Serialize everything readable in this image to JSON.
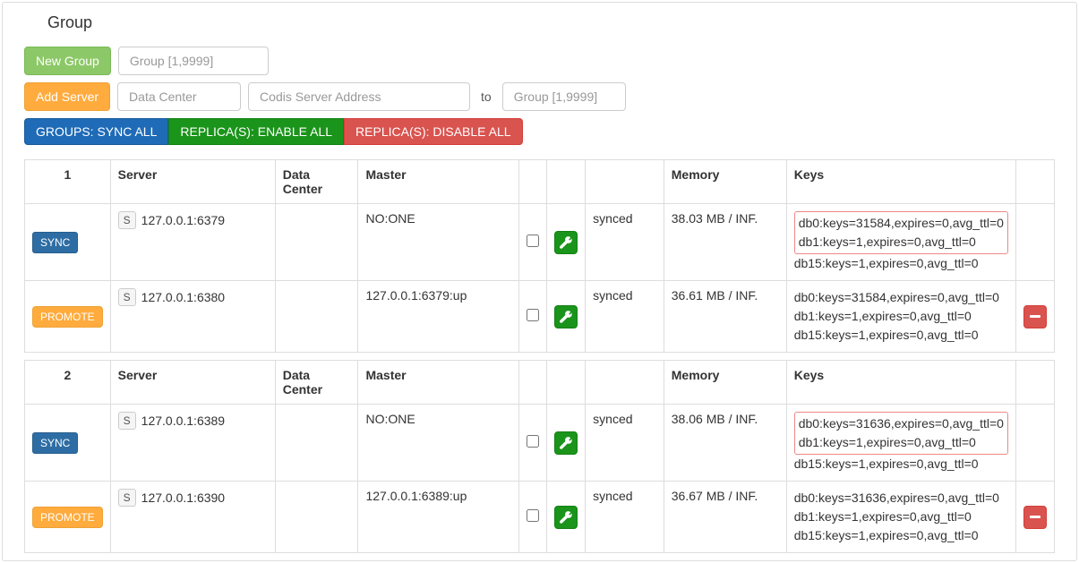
{
  "title": "Group",
  "buttons": {
    "newGroup": "New Group",
    "addServer": "Add Server",
    "syncAll": "GROUPS: SYNC ALL",
    "enableAll": "REPLICA(S): ENABLE ALL",
    "disableAll": "REPLICA(S): DISABLE ALL",
    "sync": "SYNC",
    "promote": "PROMOTE",
    "sBadge": "S"
  },
  "placeholders": {
    "groupRange": "Group [1,9999]",
    "dataCenter": "Data Center",
    "codisAddr": "Codis Server Address",
    "groupRange2": "Group [1,9999]"
  },
  "toLabel": "to",
  "headers": {
    "server": "Server",
    "dataCenter": "Data Center",
    "master": "Master",
    "memory": "Memory",
    "keys": "Keys"
  },
  "groups": [
    {
      "id": "1",
      "servers": [
        {
          "action": "sync",
          "addr": "127.0.0.1:6379",
          "dc": "",
          "master": "NO:ONE",
          "status": "synced",
          "memory": "38.03 MB / INF.",
          "keysHighlighted": [
            "db0:keys=31584,expires=0,avg_ttl=0",
            "db1:keys=1,expires=0,avg_ttl=0"
          ],
          "keysPlain": [
            "db15:keys=1,expires=0,avg_ttl=0"
          ],
          "deletable": false
        },
        {
          "action": "promote",
          "addr": "127.0.0.1:6380",
          "dc": "",
          "master": "127.0.0.1:6379:up",
          "status": "synced",
          "memory": "36.61 MB / INF.",
          "keysHighlighted": [],
          "keysPlain": [
            "db0:keys=31584,expires=0,avg_ttl=0",
            "db1:keys=1,expires=0,avg_ttl=0",
            "db15:keys=1,expires=0,avg_ttl=0"
          ],
          "deletable": true
        }
      ]
    },
    {
      "id": "2",
      "servers": [
        {
          "action": "sync",
          "addr": "127.0.0.1:6389",
          "dc": "",
          "master": "NO:ONE",
          "status": "synced",
          "memory": "38.06 MB / INF.",
          "keysHighlighted": [
            "db0:keys=31636,expires=0,avg_ttl=0",
            "db1:keys=1,expires=0,avg_ttl=0"
          ],
          "keysPlain": [
            "db15:keys=1,expires=0,avg_ttl=0"
          ],
          "deletable": false
        },
        {
          "action": "promote",
          "addr": "127.0.0.1:6390",
          "dc": "",
          "master": "127.0.0.1:6389:up",
          "status": "synced",
          "memory": "36.67 MB / INF.",
          "keysHighlighted": [],
          "keysPlain": [
            "db0:keys=31636,expires=0,avg_ttl=0",
            "db1:keys=1,expires=0,avg_ttl=0",
            "db15:keys=1,expires=0,avg_ttl=0"
          ],
          "deletable": true
        }
      ]
    }
  ]
}
